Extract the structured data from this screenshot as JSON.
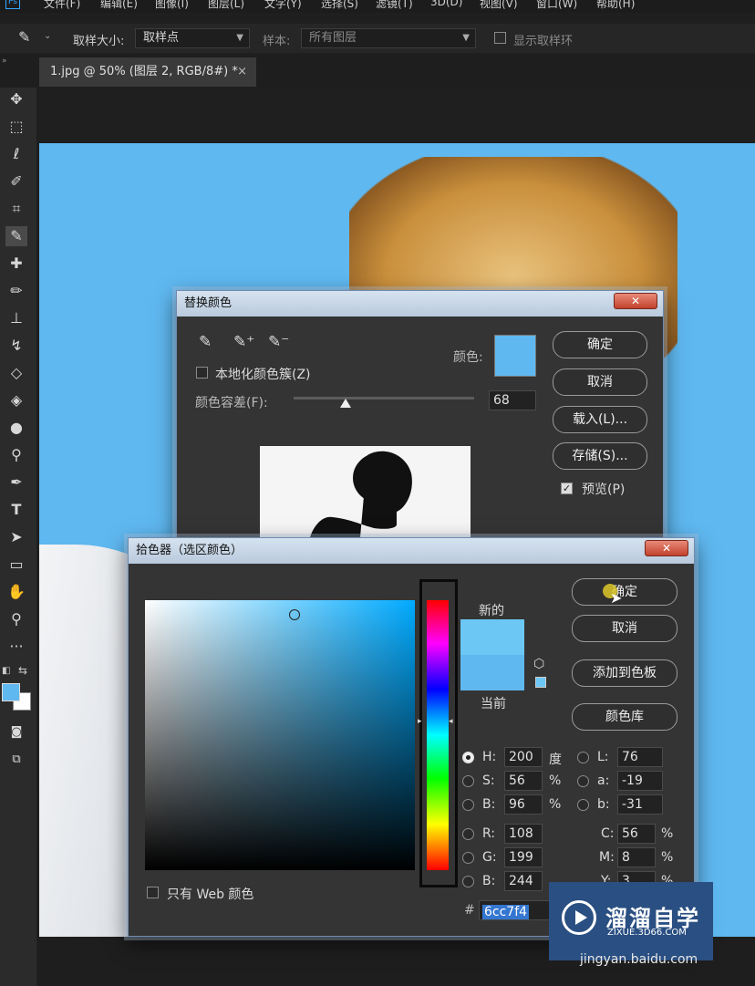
{
  "menu": [
    "文件(F)",
    "编辑(E)",
    "图像(I)",
    "图层(L)",
    "文字(Y)",
    "选择(S)",
    "滤镜(T)",
    "3D(D)",
    "视图(V)",
    "窗口(W)",
    "帮助(H)"
  ],
  "app_logo": "Ps",
  "options": {
    "sample_size_label": "取样大小:",
    "sample_size_value": "取样点",
    "sample_label": "样本:",
    "sample_value": "所有图层",
    "show_ring_label": "显示取样环"
  },
  "document_tab": {
    "title": "1.jpg @ 50% (图层 2, RGB/8#) *",
    "close": "×"
  },
  "replace_color": {
    "title": "替换颜色",
    "close": "✕",
    "localized_label": "本地化颜色簇(Z)",
    "color_label": "颜色:",
    "tolerance_label": "颜色容差(F):",
    "tolerance_value": "68",
    "tolerance_fraction": 0.29,
    "ok": "确定",
    "cancel": "取消",
    "load": "载入(L)...",
    "save": "存储(S)...",
    "preview_label": "预览(P)",
    "swatch_color": "#5fb8f0"
  },
  "color_picker": {
    "title": "拾色器（选区颜色）",
    "close": "✕",
    "new_label": "新的",
    "current_label": "当前",
    "ok": "确定",
    "cancel": "取消",
    "add_swatch": "添加到色板",
    "libraries": "颜色库",
    "web_only": "只有 Web 颜色",
    "hsb": [
      {
        "label": "H:",
        "value": "200",
        "unit": "度"
      },
      {
        "label": "S:",
        "value": "56",
        "unit": "%"
      },
      {
        "label": "B:",
        "value": "96",
        "unit": "%"
      }
    ],
    "rgb": [
      {
        "label": "R:",
        "value": "108"
      },
      {
        "label": "G:",
        "value": "199"
      },
      {
        "label": "B:",
        "value": "244"
      }
    ],
    "lab": [
      {
        "label": "L:",
        "value": "76"
      },
      {
        "label": "a:",
        "value": "-19"
      },
      {
        "label": "b:",
        "value": "-31"
      }
    ],
    "cmyk": [
      {
        "label": "C:",
        "value": "56",
        "unit": "%"
      },
      {
        "label": "M:",
        "value": "8",
        "unit": "%"
      },
      {
        "label": "Y:",
        "value": "3",
        "unit": "%"
      }
    ],
    "hex_label": "#",
    "hex": "6cc7f4",
    "new_color": "#6cc7f4",
    "current_color": "#5fb8f0"
  },
  "watermark": {
    "brand": "溜溜自学",
    "url": "ZIXUE.3D66.COM",
    "credit": "jingyan.baidu.com"
  }
}
